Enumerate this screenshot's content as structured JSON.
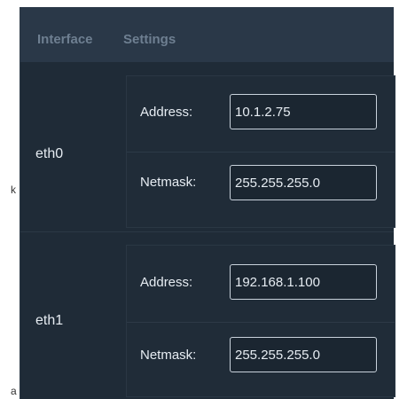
{
  "header": {
    "col_interface": "Interface",
    "col_settings": "Settings"
  },
  "interfaces": [
    {
      "name": "eth0",
      "address_label": "Address:",
      "address_value": "10.1.2.75",
      "netmask_label": "Netmask:",
      "netmask_value": "255.255.255.0"
    },
    {
      "name": "eth1",
      "address_label": "Address:",
      "address_value": "192.168.1.100",
      "netmask_label": "Netmask:",
      "netmask_value": "255.255.255.0"
    }
  ],
  "edge_glyphs": {
    "right_mid": "k",
    "bottom_left": "a"
  },
  "colors": {
    "panel_bg": "#1f2b37",
    "header_bg": "#2a3848",
    "header_text": "#6e7f91",
    "input_border": "#c9d2dc"
  }
}
